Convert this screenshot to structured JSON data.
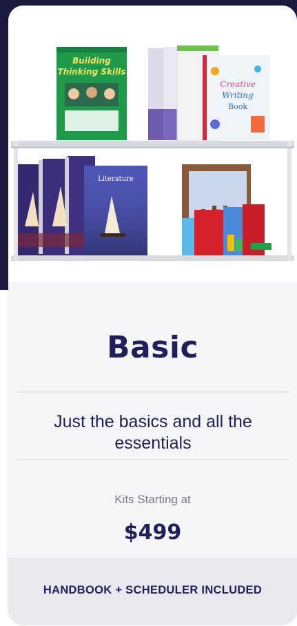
{
  "card": {
    "image_alt": "Books and math manipulatives on a white shelf",
    "book_titles": [
      "Building Thinking Skills",
      "Creative Writing Book",
      "Literature"
    ],
    "title": "Basic",
    "tagline": "Just the basics and all the essentials",
    "kits_label": "Kits Starting at",
    "price": "$499",
    "footer_text": "HANDBOOK + SCHEDULER INCLUDED"
  },
  "colors": {
    "background_dark": "#1d1a3f",
    "card": "#f6f6f9",
    "text_primary": "#1f1f5b",
    "text_muted": "#7a7a8c",
    "footer": "#e8e8ee"
  }
}
